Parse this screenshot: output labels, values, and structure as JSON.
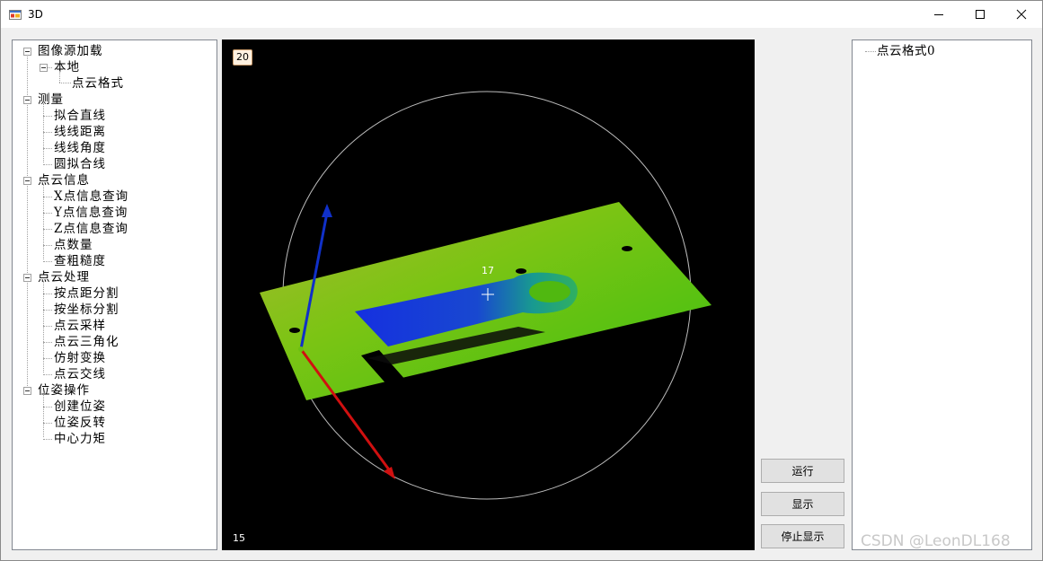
{
  "window": {
    "title": "3D",
    "controls": [
      "minimize",
      "maximize",
      "close"
    ]
  },
  "left_tree": {
    "groups": [
      {
        "label": "图像源加载",
        "children": [
          {
            "label": "本地",
            "children": [
              {
                "label": "点云格式"
              }
            ]
          }
        ]
      },
      {
        "label": "测量",
        "children": [
          {
            "label": "拟合直线"
          },
          {
            "label": "线线距离"
          },
          {
            "label": "线线角度"
          },
          {
            "label": "圆拟合线"
          }
        ]
      },
      {
        "label": "点云信息",
        "children": [
          {
            "label": "X点信息查询"
          },
          {
            "label": "Y点信息查询"
          },
          {
            "label": "Z点信息查询"
          },
          {
            "label": "点数量"
          },
          {
            "label": "查粗糙度"
          }
        ]
      },
      {
        "label": "点云处理",
        "children": [
          {
            "label": "按点距分割"
          },
          {
            "label": "按坐标分割"
          },
          {
            "label": "点云采样"
          },
          {
            "label": "点云三角化"
          },
          {
            "label": "仿射变换"
          },
          {
            "label": "点云交线"
          }
        ]
      },
      {
        "label": "位姿操作",
        "children": [
          {
            "label": "创建位姿"
          },
          {
            "label": "位姿反转"
          },
          {
            "label": "中心力矩"
          }
        ]
      }
    ]
  },
  "viewport": {
    "badge": "20",
    "center_label": "17",
    "bottom_label": "15"
  },
  "buttons": {
    "run": "运行",
    "show": "显示",
    "stop_show": "停止显示"
  },
  "right_tree": {
    "items": [
      {
        "label": "点云格式0"
      }
    ]
  },
  "watermark": "CSDN @LeonDL168",
  "colors": {
    "axis_x": "#d01010",
    "axis_z": "#1030c8",
    "plate": "#6cc010",
    "part": "#1b3cd8",
    "sphere": "#bbbbbb"
  }
}
